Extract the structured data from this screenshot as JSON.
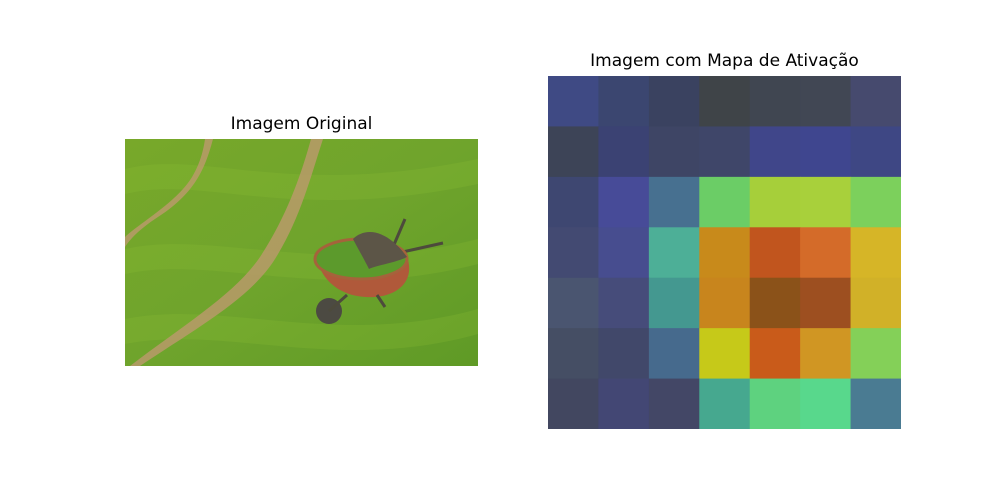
{
  "chart_data": [
    {
      "type": "image",
      "title": "Imagem Original",
      "content": "photo"
    },
    {
      "type": "heatmap",
      "title": "Imagem com Mapa de Ativação",
      "rows": 7,
      "cols": 7,
      "cell_colors": [
        [
          "#3f4a84",
          "#3b4670",
          "#3a4260",
          "#3f4448",
          "#404651",
          "#414754",
          "#464a6e"
        ],
        [
          "#3d4457",
          "#3b4273",
          "#3e4565",
          "#3f4669",
          "#40468a",
          "#3f468f",
          "#3e4784"
        ],
        [
          "#3e4771",
          "#474b98",
          "#477090",
          "#6bcd66",
          "#a6cf3a",
          "#a8d03b",
          "#7cd05c"
        ],
        [
          "#434a72",
          "#474d8f",
          "#4daf97",
          "#c88a1b",
          "#c1551e",
          "#d46b29",
          "#d6b527"
        ],
        [
          "#4a5570",
          "#464c7a",
          "#449890",
          "#c8851d",
          "#8b5219",
          "#9d4f20",
          "#d1b128"
        ],
        [
          "#454e64",
          "#41486a",
          "#466a8d",
          "#c6c919",
          "#c95b1a",
          "#d09623",
          "#84d058"
        ],
        [
          "#424760",
          "#434774",
          "#434766",
          "#46a88f",
          "#5ed27f",
          "#58d88c",
          "#4a7b92"
        ]
      ]
    }
  ]
}
